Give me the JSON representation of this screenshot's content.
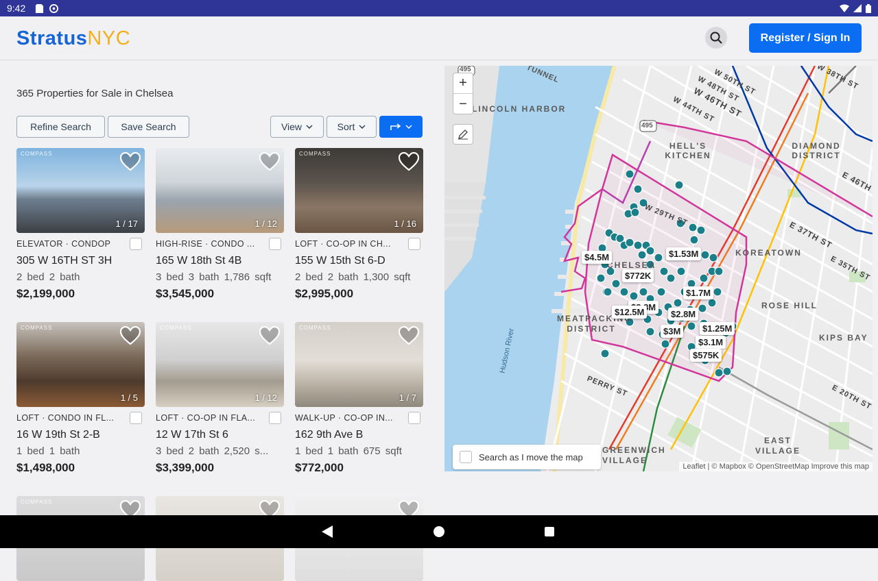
{
  "status_bar": {
    "time": "9:42"
  },
  "header": {
    "logo_primary": "Stratus",
    "logo_secondary": "NYC",
    "register_label": "Register / Sign In"
  },
  "results": {
    "title": "365 Properties for Sale in Chelsea",
    "refine_label": "Refine Search",
    "save_label": "Save Search",
    "view_label": "View",
    "sort_label": "Sort"
  },
  "listings": [
    {
      "brand": "COMPASS",
      "photo_count": "1 / 17",
      "type": "ELEVATOR · CONDOP",
      "address": "305 W 16TH ST 3H",
      "specs": "2 bed  2 bath",
      "price": "$2,199,000"
    },
    {
      "brand": "",
      "photo_count": "1 / 12",
      "type": "HIGH-RISE · CONDO ...",
      "address": "165 W 18th St 4B",
      "specs": "3 bed  3 bath  1,786 sqft",
      "price": "$3,545,000"
    },
    {
      "brand": "COMPASS",
      "photo_count": "1 / 16",
      "type": "LOFT · CO-OP IN CH...",
      "address": "155 W 15th St 6-D",
      "specs": "2 bed  2 bath  1,300 sqft",
      "price": "$2,995,000"
    },
    {
      "brand": "COMPASS",
      "photo_count": "1 / 5",
      "type": "LOFT · CONDO IN FL...",
      "address": "16 W 19th St 2-B",
      "specs": "1 bed  1 bath",
      "price": "$1,498,000"
    },
    {
      "brand": "COMPASS",
      "photo_count": "1 / 12",
      "type": "LOFT · CO-OP IN FLA...",
      "address": "12 W 17th St 6",
      "specs": "3 bed  2 bath  2,520 s...",
      "price": "$3,399,000"
    },
    {
      "brand": "COMPASS",
      "photo_count": "1 / 7",
      "type": "WALK-UP · CO-OP IN...",
      "address": "162 9th Ave B",
      "specs": "1 bed  1 bath  675 sqft",
      "price": "$772,000"
    },
    {
      "brand": "COMPASS",
      "photo_count": "",
      "type": "",
      "address": "",
      "specs": "",
      "price": ""
    },
    {
      "brand": "",
      "photo_count": "",
      "type": "",
      "address": "",
      "specs": "",
      "price": ""
    },
    {
      "brand": "",
      "photo_count": "",
      "type": "",
      "address": "",
      "specs": "",
      "price": ""
    }
  ],
  "map": {
    "zoom_in": "+",
    "zoom_out": "−",
    "search_move_label": "Search as I move the map",
    "attribution": "Leaflet | © Mapbox © OpenStreetMap Improve this map",
    "price_labels": [
      "$4.5M",
      "$1.53M",
      "$772K",
      "$1.7M",
      "$2.8M",
      "$12.5M",
      "$3M",
      "$1.25M",
      "$575K",
      "$2.8M",
      "$3.1M"
    ],
    "area_labels": [
      "HELL'S KITCHEN",
      "DIAMOND DISTRICT",
      "KOREATOWN",
      "ROSE HILL",
      "MEATPACKING DISTRICT",
      "KIPS BAY",
      "EAST VILLAGE",
      "GREENWICH VILLAGE",
      "LINCOLN HARBOR",
      "CHELSEA"
    ],
    "street_labels": [
      "W 50TH ST",
      "W 48TH ST",
      "W 46TH ST",
      "W 44TH ST",
      "W 29TH ST",
      "E 46TH",
      "E 37TH ST",
      "E 35TH ST",
      "PERRY ST",
      "E 20TH ST",
      "Hudson River",
      "W 38TH ST"
    ],
    "road_shields": [
      "495",
      "495"
    ],
    "tunnel_label": "TUNNEL",
    "colors": {
      "marker": "#1b7f8a",
      "district_outline": "#d1359a",
      "water": "#a9d3ef"
    }
  },
  "icons": [
    "search-icon",
    "heart-icon",
    "chevron-down-icon",
    "share-arrow-icon",
    "pencil-icon",
    "back-icon",
    "home-icon",
    "recents-icon",
    "wifi-icon",
    "battery-icon",
    "signal-icon"
  ]
}
